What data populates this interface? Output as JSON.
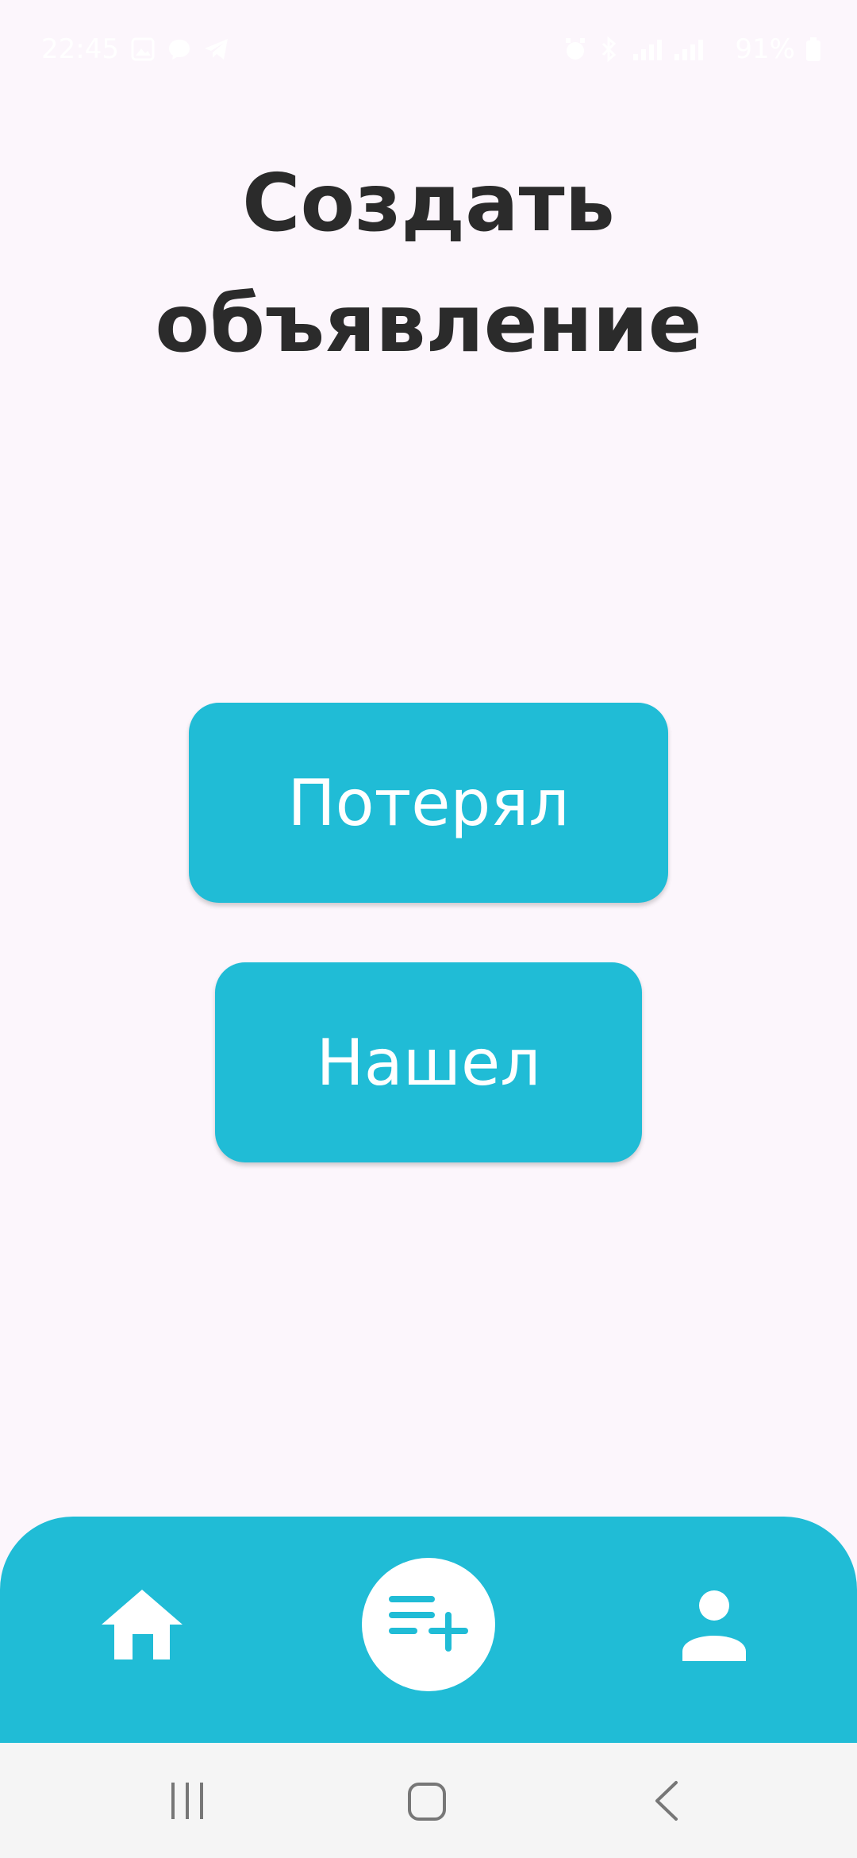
{
  "status_bar": {
    "time": "22:45",
    "battery": "91%"
  },
  "title": {
    "line1": "Создать",
    "line2": "объявление"
  },
  "buttons": {
    "lost": "Потерял",
    "found": "Нашел"
  },
  "colors": {
    "accent": "#20bcd6",
    "background": "#fcf6fc",
    "title_text": "#2b2b2b",
    "system_nav": "#f5f5f5"
  },
  "bottom_nav": {
    "icons": [
      "home-icon",
      "create-listing-icon",
      "profile-icon"
    ]
  },
  "system_nav": {
    "icons": [
      "recent-apps-icon",
      "home-button-icon",
      "back-icon"
    ]
  }
}
